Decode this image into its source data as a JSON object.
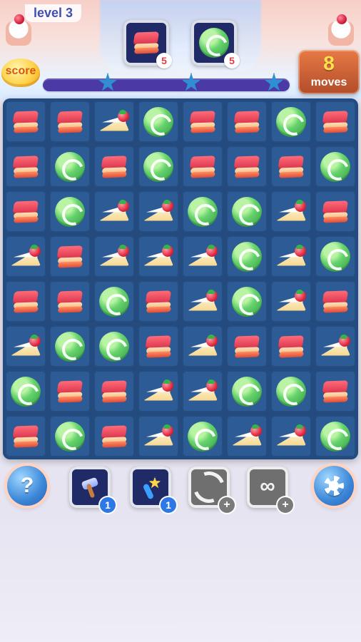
{
  "top": {
    "level_label": "level 3",
    "score_label": "score",
    "moves": {
      "value": "8",
      "label": "moves"
    },
    "progress_fraction": 0.0
  },
  "goals": [
    {
      "icon": "red-cake-icon",
      "count": "5"
    },
    {
      "icon": "green-roll-icon",
      "count": "5"
    }
  ],
  "board": {
    "rows": [
      [
        "red",
        "red",
        "cake",
        "green",
        "red",
        "red",
        "green",
        "red"
      ],
      [
        "red",
        "green",
        "red",
        "green",
        "red",
        "red",
        "red",
        "green"
      ],
      [
        "red",
        "green",
        "cake",
        "cake",
        "green",
        "green",
        "cake",
        "red"
      ],
      [
        "cake",
        "red",
        "cake",
        "cake",
        "cake",
        "green",
        "cake",
        "green"
      ],
      [
        "red",
        "red",
        "green",
        "red",
        "cake",
        "green",
        "cake",
        "red"
      ],
      [
        "cake",
        "green",
        "green",
        "red",
        "cake",
        "red",
        "red",
        "cake"
      ],
      [
        "green",
        "red",
        "red",
        "cake",
        "cake",
        "green",
        "green",
        "red"
      ],
      [
        "red",
        "green",
        "red",
        "cake",
        "green",
        "cake",
        "cake",
        "green"
      ]
    ]
  },
  "boosters": [
    {
      "name": "hammer",
      "count": "1",
      "state": "available"
    },
    {
      "name": "wand",
      "count": "1",
      "state": "available"
    },
    {
      "name": "shuffle",
      "count": "+",
      "state": "locked"
    },
    {
      "name": "infinite",
      "count": "+",
      "state": "locked"
    }
  ],
  "buttons": {
    "help_label": "?",
    "settings_icon": "gear-icon"
  }
}
